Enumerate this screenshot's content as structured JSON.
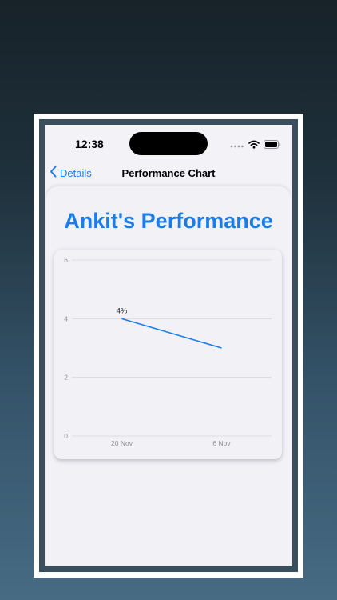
{
  "status_bar": {
    "time": "12:38"
  },
  "nav": {
    "back_label": "Details",
    "title": "Performance Chart"
  },
  "page": {
    "title": "Ankit's Performance"
  },
  "colors": {
    "accent": "#1c7ce8",
    "line": "#1a7cf0"
  },
  "chart_data": {
    "type": "line",
    "categories": [
      "20 Nov",
      "6 Nov"
    ],
    "series": [
      {
        "values": [
          4,
          3
        ]
      }
    ],
    "data_labels": [
      "4%",
      ""
    ],
    "y_ticks": [
      0,
      2,
      4,
      6
    ],
    "ylim": [
      0,
      6
    ],
    "grid": true,
    "xlabel": "",
    "ylabel": ""
  }
}
